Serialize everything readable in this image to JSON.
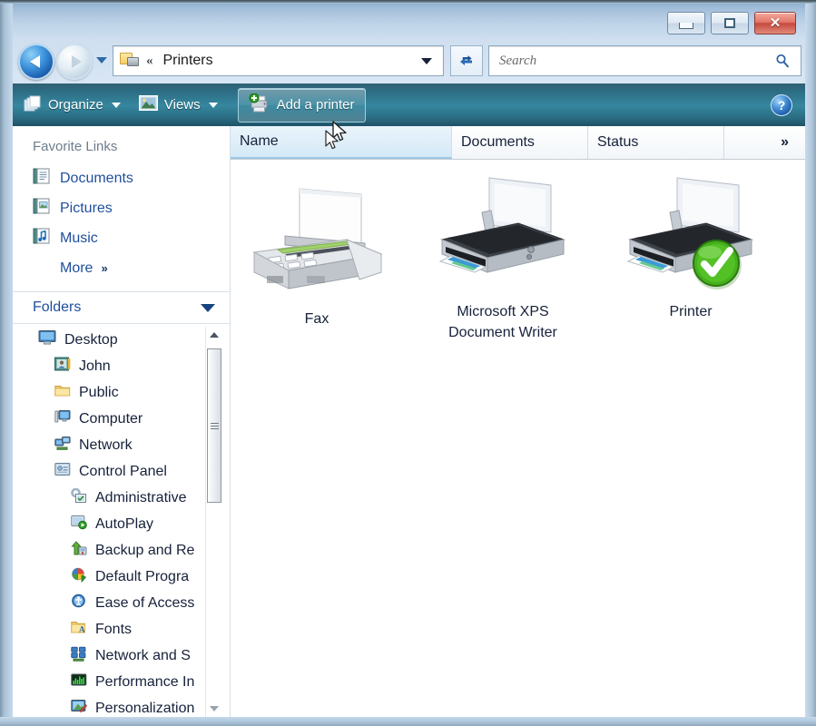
{
  "window": {
    "title": "",
    "caption_buttons": [
      {
        "name": "minimize",
        "glyph": "minimize-icon"
      },
      {
        "name": "restore",
        "glyph": "restore-icon"
      },
      {
        "name": "close",
        "glyph": "close-icon",
        "label": "✕",
        "color": "#c6493c"
      }
    ]
  },
  "addressbar": {
    "back_tooltip": "Back",
    "forward_tooltip": "Forward",
    "icon": "printers-folder-icon",
    "separator": "«",
    "crumb": "Printers",
    "refresh_icon": "refresh-icon"
  },
  "search": {
    "placeholder": "Search",
    "value": "",
    "icon": "search-icon"
  },
  "toolbar": {
    "organize_label": "Organize",
    "organize_icon": "organize-icon",
    "views_label": "Views",
    "views_icon": "views-icon",
    "add_printer_label": "Add a printer",
    "add_printer_icon": "add-printer-icon",
    "help_label": "?",
    "help_icon": "help-icon"
  },
  "navpane": {
    "favorites_title": "Favorite Links",
    "favorites": [
      {
        "label": "Documents",
        "icon": "documents-icon"
      },
      {
        "label": "Pictures",
        "icon": "pictures-icon"
      },
      {
        "label": "Music",
        "icon": "music-icon"
      }
    ],
    "more_label": "More",
    "more_chevron": "»",
    "folders_label": "Folders",
    "folders_chevron": "chevron-down-icon",
    "tree": [
      {
        "label": "Desktop",
        "icon": "desktop-icon",
        "depth": 0
      },
      {
        "label": "John",
        "icon": "user-folder-icon",
        "depth": 1
      },
      {
        "label": "Public",
        "icon": "folder-icon",
        "depth": 1
      },
      {
        "label": "Computer",
        "icon": "computer-icon",
        "depth": 1
      },
      {
        "label": "Network",
        "icon": "network-icon",
        "depth": 1
      },
      {
        "label": "Control Panel",
        "icon": "control-panel-icon",
        "depth": 1
      },
      {
        "label": "Administrative",
        "icon": "administrative-tools-icon",
        "depth": 2
      },
      {
        "label": "AutoPlay",
        "icon": "autoplay-icon",
        "depth": 2
      },
      {
        "label": "Backup and Re",
        "icon": "backup-restore-icon",
        "depth": 2
      },
      {
        "label": "Default Progra",
        "icon": "default-programs-icon",
        "depth": 2
      },
      {
        "label": "Ease of Access",
        "icon": "ease-of-access-icon",
        "depth": 2
      },
      {
        "label": "Fonts",
        "icon": "fonts-icon",
        "depth": 2
      },
      {
        "label": "Network and S",
        "icon": "network-sharing-icon",
        "depth": 2
      },
      {
        "label": "Performance In",
        "icon": "performance-icon",
        "depth": 2
      },
      {
        "label": "Personalization",
        "icon": "personalization-icon",
        "depth": 2
      }
    ],
    "scrollbar": {
      "up": "scroll-up-arrow",
      "down": "scroll-down-arrow"
    }
  },
  "listview": {
    "columns": [
      {
        "label": "Name",
        "state": "hot"
      },
      {
        "label": "Documents",
        "state": "normal"
      },
      {
        "label": "Status",
        "state": "normal"
      },
      {
        "label": "»",
        "state": "normal"
      }
    ],
    "items": [
      {
        "name": "Fax",
        "icon": "fax-machine-icon",
        "documents": "",
        "status": "",
        "default": false
      },
      {
        "name": "Microsoft XPS\nDocument Writer",
        "name_line1": "Microsoft XPS",
        "name_line2": "Document Writer",
        "icon": "printer-icon",
        "documents": "",
        "status": "",
        "default": false
      },
      {
        "name": "Printer",
        "icon": "printer-icon",
        "documents": "",
        "status": "",
        "default": true,
        "badge": "default-printer-check-icon"
      }
    ]
  },
  "colors": {
    "toolbar_gradient_top": "#2f5f74",
    "toolbar_gradient_mid": "#35879f",
    "titlebar": "#a9c3dd",
    "link": "#1f4f9e",
    "close_button": "#c6493c",
    "default_badge_green": "#3faa19"
  }
}
